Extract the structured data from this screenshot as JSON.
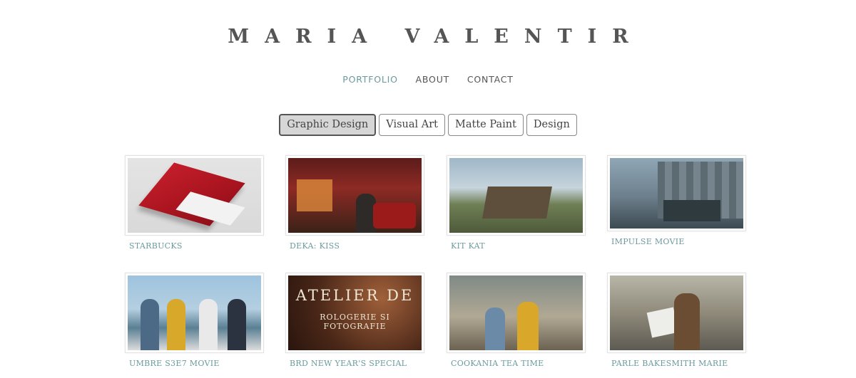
{
  "site": {
    "title": "MARIA VALENTIR"
  },
  "nav": {
    "items": [
      {
        "label": "PORTFOLIO",
        "active": true
      },
      {
        "label": "ABOUT",
        "active": false
      },
      {
        "label": "CONTACT",
        "active": false
      }
    ]
  },
  "filters": {
    "items": [
      {
        "label": "Graphic Design",
        "selected": true
      },
      {
        "label": "Visual Art",
        "selected": false
      },
      {
        "label": "Matte Paint",
        "selected": false
      },
      {
        "label": "Design",
        "selected": false
      }
    ]
  },
  "projects": [
    {
      "title": "STARBUCKS"
    },
    {
      "title": "DEKA: KISS"
    },
    {
      "title": "KIT KAT"
    },
    {
      "title": "IMPULSE MOVIE"
    },
    {
      "title": "UMBRE S3E7 MOVIE"
    },
    {
      "title": "BRD NEW YEAR'S SPECIAL",
      "image_text": [
        "ATELIER DE",
        "ROLOGERIE SI FOTOGRAFIE"
      ]
    },
    {
      "title": "COOKANIA TEA TIME"
    },
    {
      "title": "PARLE BAKESMITH MARIE"
    }
  ],
  "colors": {
    "accent": "#6a9a9d",
    "text": "#555555",
    "selected_bg": "#d6d6d6"
  }
}
